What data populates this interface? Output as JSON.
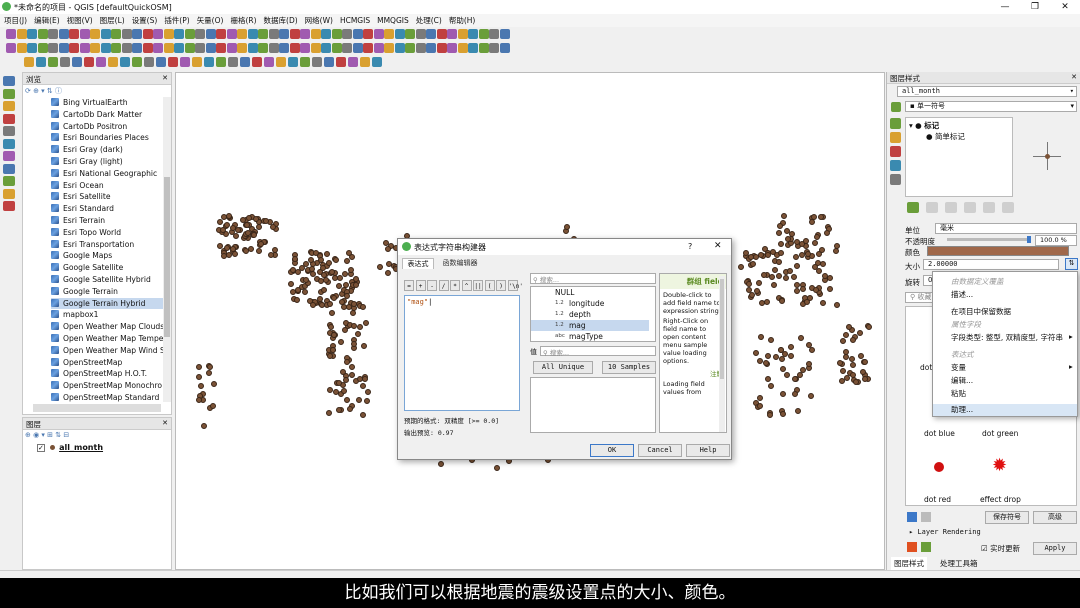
{
  "window": {
    "title": "*未命名的项目 - QGIS [defaultQuickOSM]"
  },
  "menu": [
    "项目(J)",
    "编辑(E)",
    "视图(V)",
    "图层(L)",
    "设置(S)",
    "插件(P)",
    "矢量(O)",
    "栅格(R)",
    "数据库(D)",
    "网络(W)",
    "HCMGIS",
    "MMQGIS",
    "处理(C)",
    "帮助(H)"
  ],
  "browser": {
    "title": "浏览",
    "items": [
      "Bing VirtualEarth",
      "CartoDb Dark Matter",
      "CartoDb Positron",
      "Esri Boundaries Places",
      "Esri Gray (dark)",
      "Esri Gray (light)",
      "Esri National Geographic",
      "Esri Ocean",
      "Esri Satellite",
      "Esri Standard",
      "Esri Terrain",
      "Esri Topo World",
      "Esri Transportation",
      "Google Maps",
      "Google Satellite",
      "Google Satellite Hybrid",
      "Google Terrain",
      "Google Terrain Hybrid",
      "mapbox1",
      "Open Weather Map Clouds",
      "Open Weather Map Tempe",
      "Open Weather Map Wind S",
      "OpenStreetMap",
      "OpenStreetMap H.O.T.",
      "OpenStreetMap Monochro",
      "OpenStreetMap Standard"
    ],
    "selected_index": 17
  },
  "layers": {
    "title": "图层",
    "layer_name": "all_month"
  },
  "dialog": {
    "title": "表达式字符串构建器",
    "help": "?",
    "close": "✕",
    "tab_expr": "表达式",
    "tab_func": "函数编辑器",
    "operators": [
      "=",
      "+",
      "-",
      "/",
      "*",
      "^",
      "||",
      "(",
      ")",
      "'\\n'"
    ],
    "expression": "\"mag\"",
    "search_placeholder": "搜索...",
    "fields": [
      {
        "type": "",
        "name": "NULL"
      },
      {
        "type": "1.2",
        "name": "longitude"
      },
      {
        "type": "1.2",
        "name": "depth"
      },
      {
        "type": "1.2",
        "name": "mag"
      },
      {
        "type": "abc",
        "name": "magType"
      }
    ],
    "selected_field": 3,
    "values_label": "值",
    "values_placeholder": "搜索...",
    "all_unique": "All Unique",
    "samples": "10 Samples",
    "format_line": "预期的格式: 双精度 [>= 0.0]",
    "preview_line": "输出预览: 0.97",
    "help_title": "群组 field",
    "help_body1": "Double-click to add field name to expression string.",
    "help_body2": "Right-Click on field name to open content menu sample value loading options.",
    "help_notes": "注解",
    "help_body3": "Loading field values from",
    "ok": "OK",
    "cancel": "Cancel",
    "help_btn": "Help"
  },
  "style_panel": {
    "title": "图层样式",
    "layer_combo": "all_month",
    "renderer_combo": "单一符号",
    "tree_marker": "标记",
    "tree_simple": "简单标记",
    "unit_label": "单位",
    "unit_value": "毫米",
    "opacity_label": "不透明度",
    "opacity_value": "100.0 %",
    "color_label": "颜色",
    "size_label": "大小",
    "size_value": "2.00000",
    "rotation_label": "旋转",
    "rotation_value": "0.",
    "search_placeholder": "收藏",
    "symbols": [
      "dot blue",
      "dot green",
      "dot red",
      "effect drop"
    ],
    "save_symbol": "保存符号",
    "advanced": "高级",
    "layer_rendering": "Layer Rendering",
    "live_update": "实时更新",
    "apply": "Apply",
    "tab_style": "图层样式",
    "tab_toolbox": "处理工具箱",
    "dot_label": "dot",
    "colors": {
      "brown": "#a0684a",
      "red": "#d01010"
    }
  },
  "context_menu": {
    "header1": "由数据定义覆盖",
    "item_desc": "描述...",
    "item_store": "在项目中保留数据",
    "header2": "属性字段",
    "item_field_type": "字段类型: 整型, 双精度型, 字符串",
    "header3": "表达式",
    "item_var": "变量",
    "item_edit": "编辑...",
    "item_paste": "粘贴",
    "item_help": "助理..."
  },
  "subtitle": "比如我们可以根据地震的震级设置点的大小、颜色。"
}
